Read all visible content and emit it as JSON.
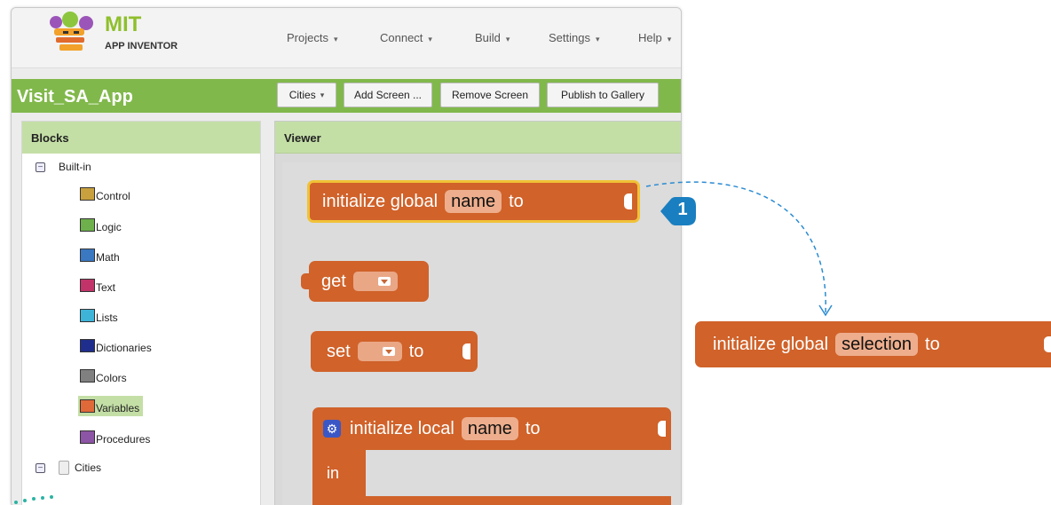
{
  "logo": {
    "title": "MIT",
    "subtitle": "APP INVENTOR"
  },
  "menu": [
    {
      "label": "Projects"
    },
    {
      "label": "Connect"
    },
    {
      "label": "Build"
    },
    {
      "label": "Settings"
    },
    {
      "label": "Help"
    }
  ],
  "project": {
    "name": "Visit_SA_App",
    "screen_select": "Cities",
    "add_screen": "Add Screen ...",
    "remove_screen": "Remove Screen",
    "publish": "Publish to Gallery"
  },
  "blocks_panel": {
    "title": "Blocks",
    "builtin_label": "Built-in",
    "items": [
      {
        "label": "Control",
        "color": "#c8a03e",
        "icon": "control-swatch"
      },
      {
        "label": "Logic",
        "color": "#6eb04c",
        "icon": "logic-swatch"
      },
      {
        "label": "Math",
        "color": "#3a78c2",
        "icon": "math-swatch"
      },
      {
        "label": "Text",
        "color": "#c2336a",
        "icon": "text-swatch"
      },
      {
        "label": "Lists",
        "color": "#3fb4d9",
        "icon": "lists-swatch"
      },
      {
        "label": "Dictionaries",
        "color": "#1f2e8c",
        "icon": "dictionaries-swatch"
      },
      {
        "label": "Colors",
        "color": "#808080",
        "icon": "colors-swatch"
      },
      {
        "label": "Variables",
        "color": "#e0693a",
        "icon": "variables-swatch",
        "selected": true
      },
      {
        "label": "Procedures",
        "color": "#8d55a5",
        "icon": "procedures-swatch"
      }
    ],
    "cities_label": "Cities"
  },
  "viewer": {
    "title": "Viewer",
    "blocks": {
      "init_global_prefix": "initialize global",
      "init_global_name": "name",
      "init_global_to": "to",
      "get_label": "get",
      "set_label": "set",
      "set_to": "to",
      "init_local_prefix": "initialize local",
      "init_local_name": "name",
      "init_local_to": "to",
      "init_local_in": "in"
    }
  },
  "callout": {
    "number": "1",
    "prefix": "initialize global",
    "name": "selection",
    "to": "to"
  },
  "colors": {
    "block": "#d0622a",
    "accent_green": "#81b84b",
    "callout_blue": "#1a7fc0"
  }
}
